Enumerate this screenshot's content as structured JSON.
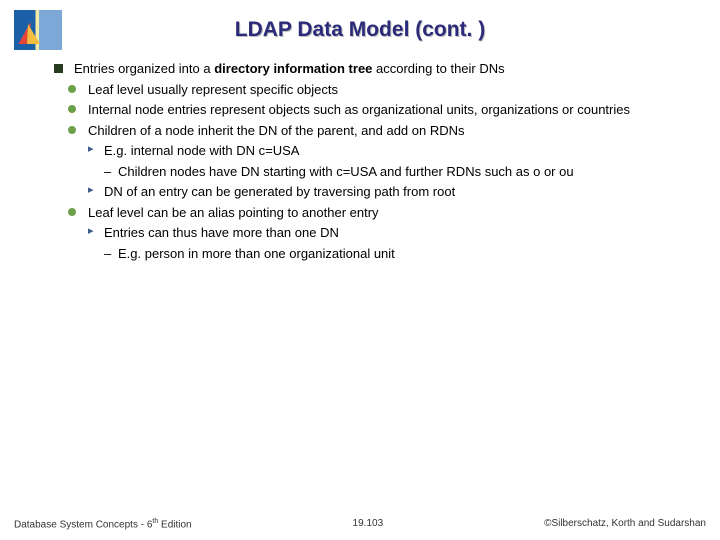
{
  "title": "LDAP Data Model (cont. )",
  "main_point_pre": "Entries organized into a ",
  "main_point_bold": "directory information tree",
  "main_point_post": " according to their DNs",
  "sub": {
    "a": "Leaf level usually represent specific objects",
    "b": "Internal node entries represent objects such as organizational units, organizations or countries",
    "c": "Children of a node inherit the DN of the parent, and add on RDNs",
    "c1": "E.g. internal node with DN c=USA",
    "c1a": "Children nodes have DN starting with c=USA and further RDNs such as o or ou",
    "c2": "DN of an entry can be generated by traversing path from root",
    "d": "Leaf level can be an alias pointing to another entry",
    "d1": "Entries can thus have more than one DN",
    "d1a": "E.g. person in more than one organizational unit"
  },
  "footer": {
    "left_pre": "Database System Concepts - 6",
    "left_sup": "th",
    "left_post": " Edition",
    "center": "19.103",
    "right": "©Silberschatz, Korth and Sudarshan"
  }
}
